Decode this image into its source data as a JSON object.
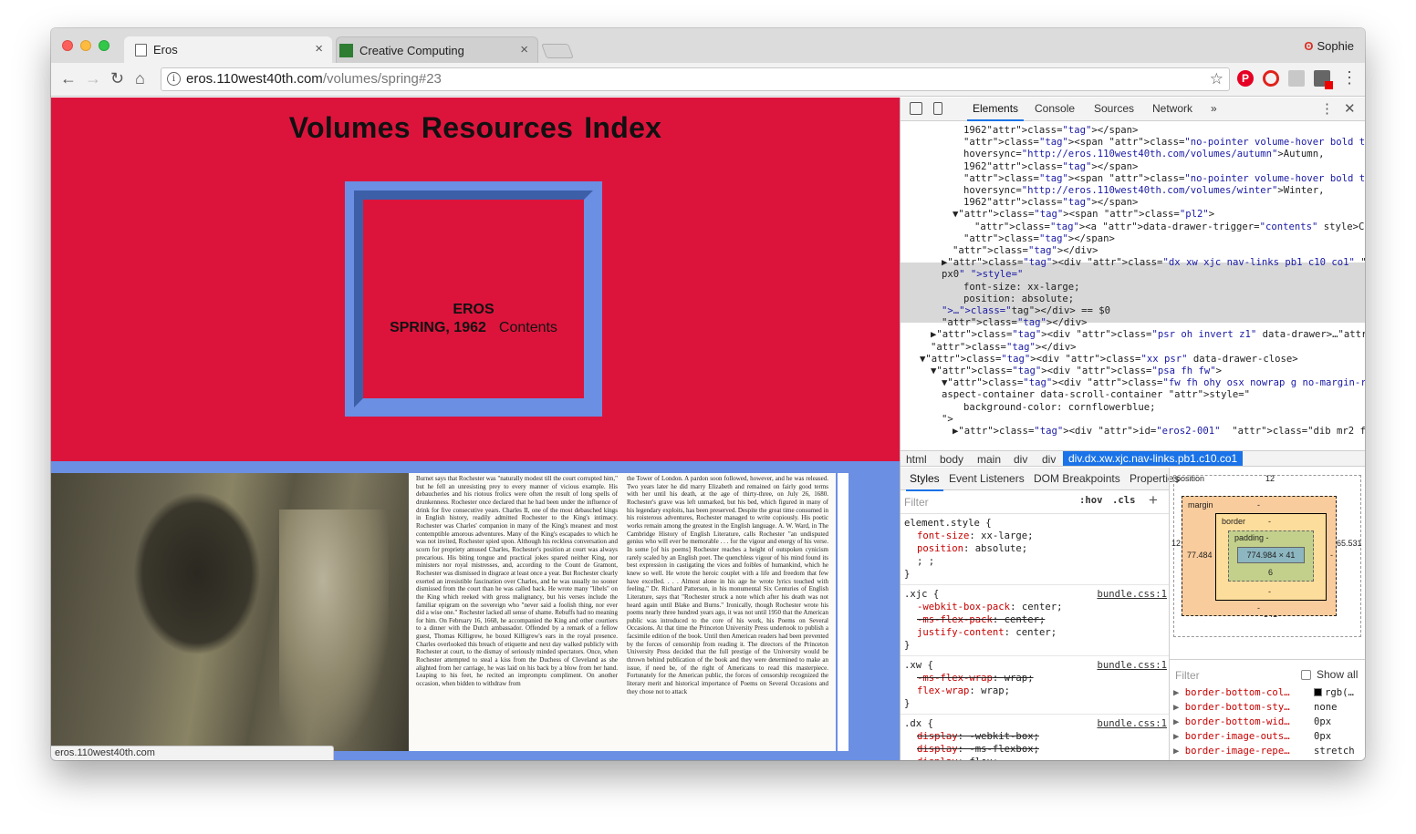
{
  "browser": {
    "tabs": [
      {
        "title": "Eros",
        "close": "×"
      },
      {
        "title": "Creative Computing",
        "close": "×"
      }
    ],
    "profile_name": "Sophie",
    "url_host": "eros.110west40th.com",
    "url_path": "/volumes/spring#23",
    "status_url": "eros.110west40th.com"
  },
  "page": {
    "nav": [
      "Volumes",
      "Resources",
      "Index"
    ],
    "cover_title": "EROS",
    "cover_issue": "SPRING, 1962",
    "cover_link": "Contents",
    "colors": {
      "hero": "#dc143c",
      "accent": "#6b8fe3",
      "accent_dark": "#3d5fa8"
    },
    "scan_col1": "Burnet says that Rochester was \"naturally modest till the court corrupted him,\" but he fell an unresisting prey to every manner of vicious example. His debaucheries and his riotous frolics were often the result of long spells of drunkenness. Rochester once declared that he had been under the influence of drink for five consecutive years. Charles II, one of the most debauched kings in English history, readily admitted Rochester to the King's intimacy. Rochester was Charles' companion in many of the King's meanest and most contemptible amorous adventures. Many of the King's escapades to which he was not invited, Rochester spied upon. Although his reckless conversation and scorn for propriety amused Charles, Rochester's position at court was always precarious. His biting tongue and practical jokes spared neither King, nor ministers nor royal mistresses, and, according to the Count de Gramont, Rochester was dismissed in disgrace at least once a year. But Rochester clearly exerted an irresistible fascination over Charles, and he was usually no sooner dismissed from the court than he was called back. He wrote many \"libels\" on the King which reeked with gross malignancy, but his verses include the familiar epigram on the sovereign who \"never said a foolish thing, nor ever did a wise one.\" Rochester lacked all sense of shame. Rebuffs had no meaning for him. On February 16, 1668, he accompanied the King and other courtiers to a dinner with the Dutch ambassador. Offended by a remark of a fellow guest, Thomas Killigrew, he boxed Killigrew's ears in the royal presence. Charles overlooked this breach of etiquette and next day walked publicly with Rochester at court, to the dismay of seriously minded spectators. Once, when Rochester attempted to steal a kiss from the Duchess of Cleveland as she alighted from her carriage, he was laid on his back by a blow from her hand. Leaping to his feet, he recited an impromptu compliment. On another occasion, when bidden to withdraw from",
    "scan_col2": "the Tower of London. A pardon soon followed, however, and he was released. Two years later he did marry Elizabeth and remained on fairly good terms with her until his death, at the age of thirty-three, on July 26, 1680. Rochester's grave was left unmarked, but his bed, which figured in many of his legendary exploits, has been preserved. Despite the great time consumed in his roisterous adventures, Rochester managed to write copiously. His poetic works remain among the greatest in the English language. A. W. Ward, in The Cambridge History of English Literature, calls Rochester \"an undisputed genius who will ever be memorable . . . for the vigour and energy of his verse. In some [of his poems] Rochester reaches a height of outspoken cynicism rarely scaled by an English poet. The quenchless vigour of his mind found its best expression in castigating the vices and foibles of humankind, which he knew so well. He wrote the heroic couplet with a life and freedom that few have excelled. . . . Almost alone in his age he wrote lyrics touched with feeling.\" Dr. Richard Patterson, in his monumental Six Centuries of English Literature, says that \"Rochester struck a note which after his death was not heard again until Blake and Burns.\" Ironically, though Rochester wrote his poems nearly three hundred years ago, it was not until 1950 that the American public was introduced to the core of his work, his Poems on Several Occasions. At that time the Princeton University Press undertook to publish a facsimile edition of the book. Until then American readers had been prevented by the forces of censorship from reading it. The directors of the Princeton University Press decided that the full prestige of the University would be thrown behind publication of the book and they were determined to make an issue, if need be, of the right of Americans to read this masterpiece. Fortunately for the American public, the forces of censorship recognized the literary merit and historical importance of Poems on Several Occasions and they chose not to attack"
  },
  "devtools": {
    "tabs": [
      "Elements",
      "Console",
      "Sources",
      "Network",
      "»"
    ],
    "dom_lines": [
      {
        "ind": 7,
        "h": "1962</span>"
      },
      {
        "ind": 7,
        "h": "<span class=\"no-pointer volume-hover bold ttu \" md=\"ttn\" data-"
      },
      {
        "ind": 7,
        "h": "hoversync=\"http://eros.110west40th.com/volumes/autumn\">Autumn,"
      },
      {
        "ind": 7,
        "h": "1962</span>"
      },
      {
        "ind": 7,
        "h": "<span class=\"no-pointer volume-hover bold ttu \" md=\"ttn\" data-"
      },
      {
        "ind": 7,
        "h": "hoversync=\"http://eros.110west40th.com/volumes/winter\">Winter,"
      },
      {
        "ind": 7,
        "h": "1962</span>"
      },
      {
        "ind": 6,
        "h": "▼<span class=\"pl2\">"
      },
      {
        "ind": 8,
        "h": "<a data-drawer-trigger=\"contents\" style>Contents</a>"
      },
      {
        "ind": 7,
        "h": "</span>"
      },
      {
        "ind": 6,
        "h": "</div>"
      },
      {
        "ind": 5,
        "h": "▶<div class=\"dx xw xjc nav-links pb1 c10 co1\" md=\"wauto  co0 pb0"
      },
      {
        "ind": 5,
        "h": "px0\" style=\""
      },
      {
        "ind": 7,
        "h": "font-size: xx-large;"
      },
      {
        "ind": 7,
        "h": "position: absolute;"
      },
      {
        "ind": 5,
        "h": "\">…</div> == $0"
      },
      {
        "ind": 5,
        "h": "</div>"
      },
      {
        "ind": 4,
        "h": "▶<div class=\"psr oh invert z1\" data-drawer>…</div>"
      },
      {
        "ind": 4,
        "h": "</div>"
      },
      {
        "ind": 3,
        "h": "▼<div class=\"xx psr\" data-drawer-close>"
      },
      {
        "ind": 4,
        "h": "▼<div class=\"psa fh fw\">"
      },
      {
        "ind": 5,
        "h": "▼<div class=\"fw fh ohy osx nowrap g no-margin-right-last\" data-"
      },
      {
        "ind": 5,
        "h": "aspect-container data-scroll-container style=\""
      },
      {
        "ind": 7,
        "h": "background-color: cornflowerblue;"
      },
      {
        "ind": 5,
        "h": "\">"
      },
      {
        "ind": 6,
        "h": "▶<div id=\"eros2-001\"  class=\"dib mr2 fh psr bgrn bgpc image-"
      }
    ],
    "breadcrumbs": [
      "html",
      "body",
      "main",
      "div",
      "div",
      "div.dx.xw.xjc.nav-links.pb1.c10.co1"
    ],
    "sub_tabs": [
      "Styles",
      "Event Listeners",
      "DOM Breakpoints",
      "Properties"
    ],
    "filter_placeholder": "Filter",
    "hov": ":hov",
    "cls": ".cls",
    "plus": "+",
    "rules": [
      {
        "selector": "element.style {",
        "source": "",
        "props": [
          {
            "t": "font-size: xx-large;",
            "s": false
          },
          {
            "t": "position: absolute;",
            "s": false
          },
          {
            "t": "; ;",
            "s": false
          }
        ]
      },
      {
        "selector": ".xjc {",
        "source": "bundle.css:1",
        "props": [
          {
            "t": "-webkit-box-pack: center;",
            "s": false
          },
          {
            "t": "-ms-flex-pack: center;",
            "s": true
          },
          {
            "t": "justify-content: center;",
            "s": false
          }
        ]
      },
      {
        "selector": ".xw {",
        "source": "bundle.css:1",
        "props": [
          {
            "t": "-ms-flex-wrap: wrap;",
            "s": true
          },
          {
            "t": "flex-wrap: wrap;",
            "s": false
          }
        ]
      },
      {
        "selector": ".dx {",
        "source": "bundle.css:1",
        "props": [
          {
            "t": "display: -webkit-box;",
            "s": true
          },
          {
            "t": "display: -ms-flexbox;",
            "s": true
          },
          {
            "t": "display: flex;",
            "s": true
          }
        ]
      }
    ],
    "box_model": {
      "position_label": "position",
      "position_top": "12",
      "position_left": "12",
      "position_right": "65.531",
      "margin_label": "margin",
      "margin_top": "-",
      "margin_bottom": "-",
      "margin_left": "77.484",
      "margin_right": "-",
      "border_label": "border",
      "border_top": "-",
      "border_bottom": "-",
      "padding_label": "padding -",
      "padding_bottom": "6",
      "content": "774.984 × 41",
      "position_bottom": "341"
    },
    "computed_filter": "Filter",
    "show_all": "Show all",
    "computed": [
      {
        "name": "border-bottom-col…",
        "value": "rgb(…",
        "swatch": true
      },
      {
        "name": "border-bottom-sty…",
        "value": "none",
        "swatch": false
      },
      {
        "name": "border-bottom-wid…",
        "value": "0px",
        "swatch": false
      },
      {
        "name": "border-image-outs…",
        "value": "0px",
        "swatch": false
      },
      {
        "name": "border-image-repe…",
        "value": "stretch",
        "swatch": false
      }
    ]
  }
}
